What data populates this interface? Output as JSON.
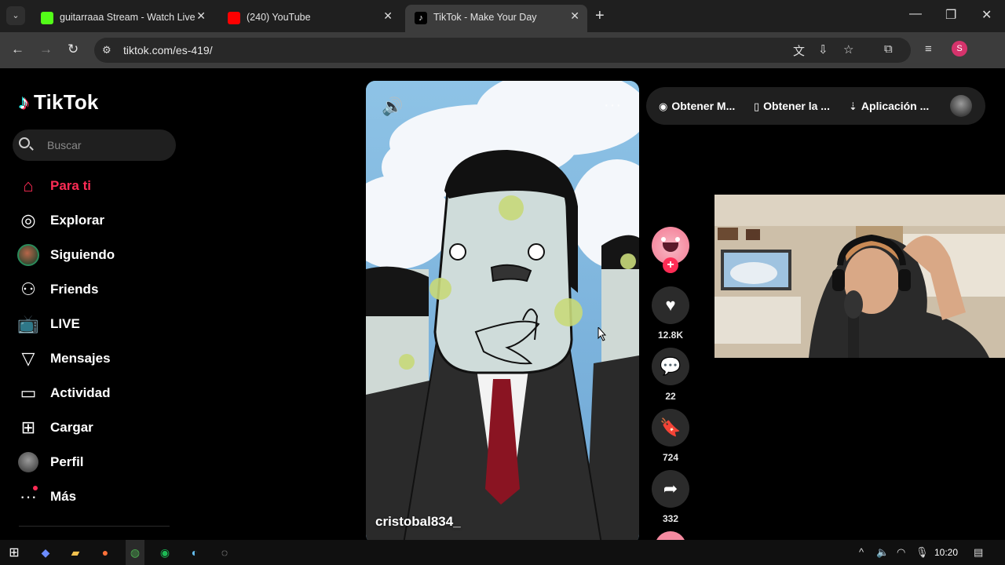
{
  "browser": {
    "tabs": [
      {
        "title": "guitarraaa Stream - Watch Live",
        "active": false
      },
      {
        "title": "(240) YouTube",
        "active": false
      },
      {
        "title": "TikTok - Make Your Day",
        "active": true
      }
    ],
    "url": "tiktok.com/es-419/",
    "profile_initial": "S"
  },
  "tiktok": {
    "logo_text": "TikTok",
    "search_placeholder": "Buscar",
    "nav": [
      {
        "label": "Para ti",
        "icon": "home-icon",
        "active": true
      },
      {
        "label": "Explorar",
        "icon": "compass-icon"
      },
      {
        "label": "Siguiendo",
        "icon": "avatar"
      },
      {
        "label": "Friends",
        "icon": "friends-icon"
      },
      {
        "label": "LIVE",
        "icon": "live-icon"
      },
      {
        "label": "Mensajes",
        "icon": "send-icon"
      },
      {
        "label": "Actividad",
        "icon": "inbox-icon"
      },
      {
        "label": "Cargar",
        "icon": "upload-icon"
      },
      {
        "label": "Perfil",
        "icon": "avatar"
      },
      {
        "label": "Más",
        "icon": "more-icon"
      }
    ],
    "top_links": [
      "Obtener M...",
      "Obtener la ...",
      "Aplicación ..."
    ],
    "video": {
      "author": "cristobal834_"
    },
    "actions": {
      "likes": "12.8K",
      "comments": "22",
      "saves": "724",
      "shares": "332"
    },
    "colors": {
      "accent": "#fe2c55",
      "cyan": "#25f4ee"
    }
  },
  "taskbar": {
    "time": "10:20"
  }
}
